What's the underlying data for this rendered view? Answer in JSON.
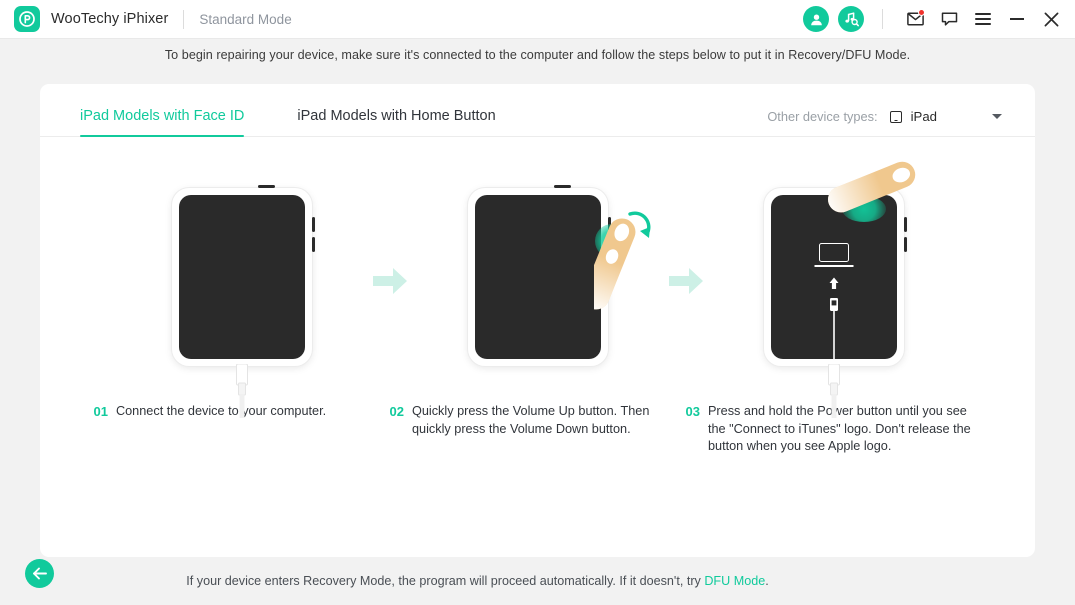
{
  "titlebar": {
    "app_name": "WooTechy iPhixer",
    "mode": "Standard Mode",
    "logo_icon": "p-logo-icon",
    "account_icon": "account-icon",
    "music-repair_icon": "music-repair-icon",
    "mail_icon": "mail-icon",
    "feedback_icon": "chat-bubble-icon",
    "menu_icon": "hamburger-menu-icon",
    "minimize_icon": "minimize-icon",
    "close_icon": "close-icon",
    "accent_color": "#11ca9c",
    "badge_color": "#f0322c"
  },
  "banner": {
    "text": "To begin repairing your device, make sure it's connected to the computer and follow the steps below to put it in Recovery/DFU Mode."
  },
  "tabs": [
    {
      "label": "iPad Models with Face ID",
      "active": true
    },
    {
      "label": "iPad Models with Home Button",
      "active": false
    }
  ],
  "device_select": {
    "label": "Other device types:",
    "value": "iPad",
    "glyph": "ipad-glyph-icon",
    "caret": "chevron-down-icon"
  },
  "steps": [
    {
      "number": "01",
      "text": "Connect the device to your computer."
    },
    {
      "number": "02",
      "text": "Quickly press the Volume Up button. Then quickly press the Volume Down button."
    },
    {
      "number": "03",
      "text": "Press and hold the Power button until you see the \"Connect to iTunes\" logo. Don't release the button when you see Apple logo."
    }
  ],
  "footer": {
    "back_icon": "back-arrow-icon",
    "text_before": "If your device enters Recovery Mode, the program will proceed automatically. If it doesn't, try ",
    "link": "DFU Mode",
    "text_after": "."
  }
}
